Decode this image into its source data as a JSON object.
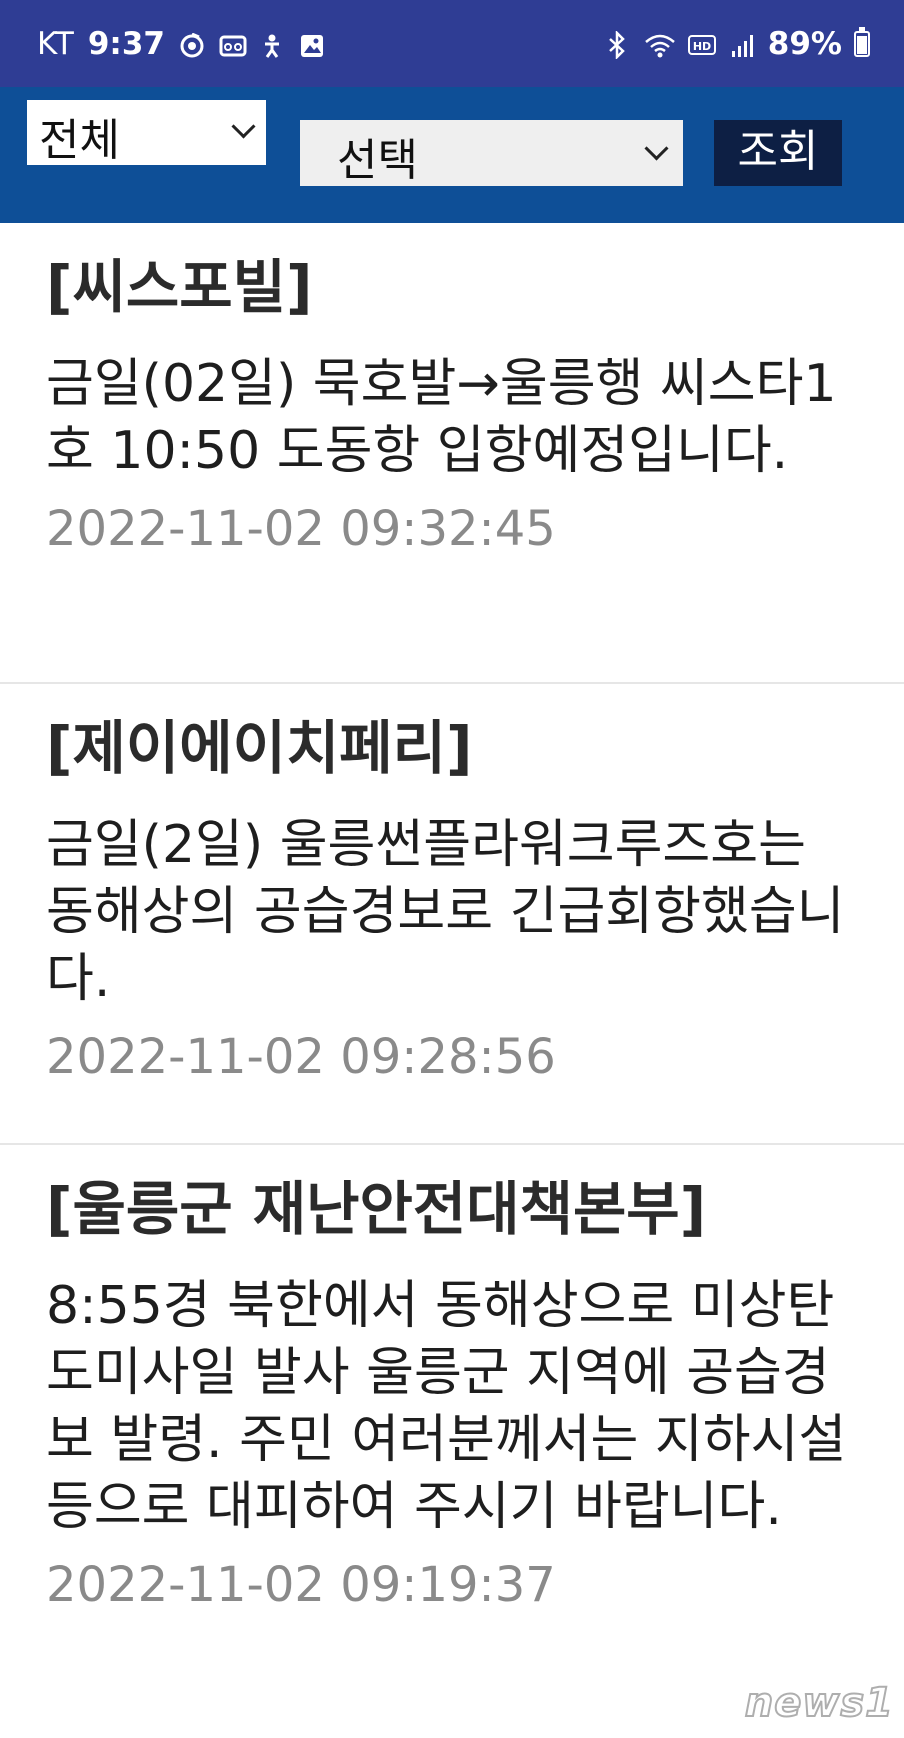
{
  "status_bar": {
    "carrier": "KT",
    "time": "9:37",
    "battery": "89%",
    "battery_level": 0.89,
    "left_icons": [
      "sync-icon",
      "voicemail-icon",
      "accessibility-icon",
      "gallery-icon"
    ],
    "right_icons": [
      "bluetooth-icon",
      "wifi-icon",
      "hd-voice-icon",
      "signal-icon",
      "battery-icon"
    ]
  },
  "toolbar": {
    "region_select": "전체",
    "category_select": "선택",
    "query_label": "조회",
    "colors": {
      "bar": "#0e4f97",
      "button": "#0d1f44"
    }
  },
  "notices": [
    {
      "source": "[씨스포빌]",
      "message": "금일(02일) 묵호발→울릉행 씨스타1호 10:50 도동항 입항예정입니다.",
      "timestamp": "2022-11-02 09:32:45"
    },
    {
      "source": "[제이에이치페리]",
      "message": "금일(2일) 울릉썬플라워크루즈호는 동해상의 공습경보로 긴급회항했습니다.",
      "timestamp": "2022-11-02 09:28:56"
    },
    {
      "source": "[울릉군 재난안전대책본부]",
      "message": "8:55경 북한에서 동해상으로 미상탄도미사일 발사 울릉군 지역에 공습경보 발령. 주민 여러분께서는 지하시설 등으로 대피하여 주시기 바랍니다.",
      "timestamp": "2022-11-02 09:19:37"
    }
  ],
  "watermark": "news1"
}
